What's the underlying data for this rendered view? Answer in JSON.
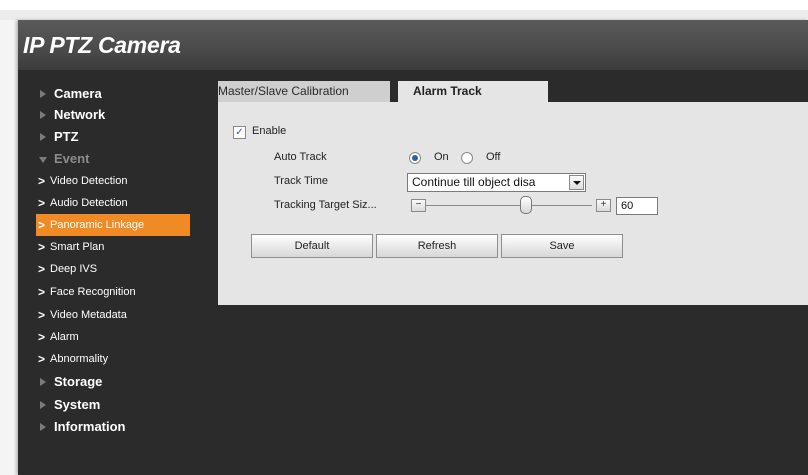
{
  "app": {
    "title": "IP PTZ Camera"
  },
  "sidebar": {
    "top_items": [
      {
        "label": "Camera"
      },
      {
        "label": "Network"
      },
      {
        "label": "PTZ"
      },
      {
        "label": "Event"
      }
    ],
    "event_sub_items": [
      {
        "label": "Video Detection"
      },
      {
        "label": "Audio Detection"
      },
      {
        "label": "Panoramic Linkage"
      },
      {
        "label": "Smart Plan"
      },
      {
        "label": "Deep IVS"
      },
      {
        "label": "Face Recognition"
      },
      {
        "label": "Video Metadata"
      },
      {
        "label": "Alarm"
      },
      {
        "label": "Abnormality"
      }
    ],
    "bottom_items": [
      {
        "label": "Storage"
      },
      {
        "label": "System"
      },
      {
        "label": "Information"
      }
    ]
  },
  "tabs": [
    {
      "label": "Master/Slave Calibration"
    },
    {
      "label": "Alarm Track"
    }
  ],
  "form": {
    "enable_label": "Enable",
    "enable_checked": true,
    "auto_track_label": "Auto Track",
    "auto_track_on": "On",
    "auto_track_off": "Off",
    "auto_track_value": "On",
    "track_time_label": "Track Time",
    "track_time_value": "Continue till object disa",
    "target_size_label": "Tracking Target Siz...",
    "target_size_value": "60",
    "minus": "−",
    "plus": "+"
  },
  "buttons": {
    "default": "Default",
    "refresh": "Refresh",
    "save": "Save"
  },
  "colors": {
    "accent": "#ef8a25",
    "background": "#2b2b2b",
    "panel": "#e5e5e5"
  }
}
